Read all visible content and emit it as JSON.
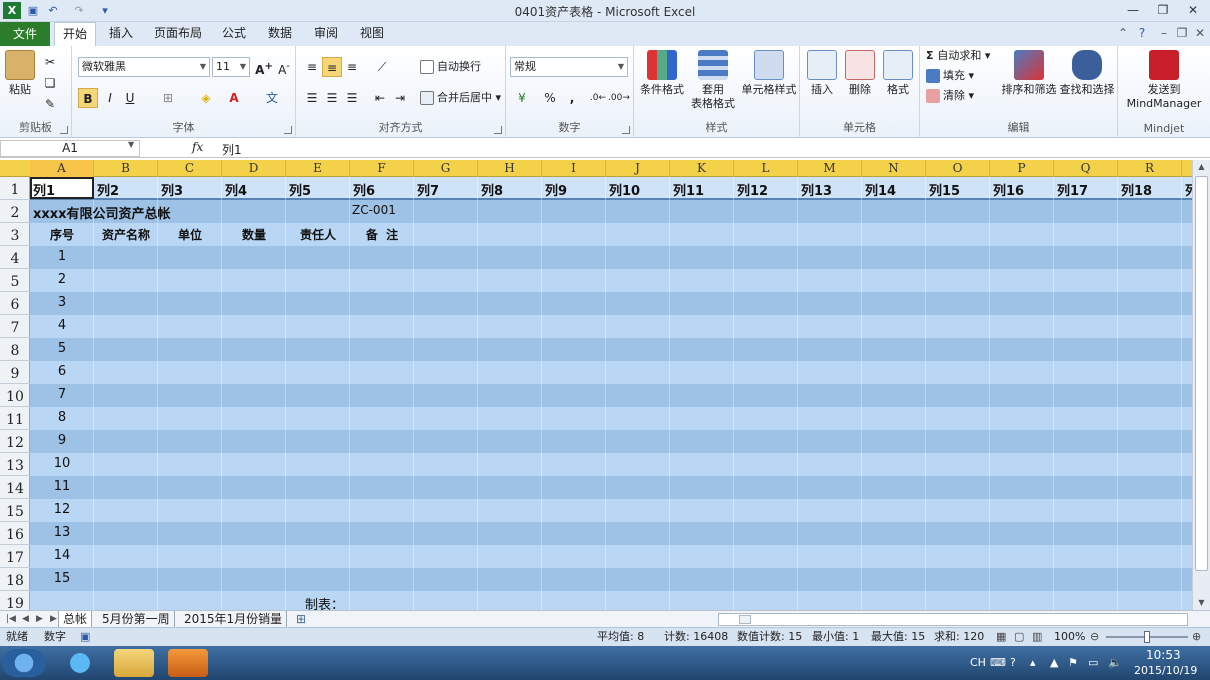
{
  "window": {
    "title": "0401资产表格 - Microsoft Excel"
  },
  "ribbon_tabs": [
    "文件",
    "开始",
    "插入",
    "页面布局",
    "公式",
    "数据",
    "审阅",
    "视图"
  ],
  "clipboard": {
    "paste": "粘贴",
    "label": "剪贴板"
  },
  "font": {
    "name": "微软雅黑",
    "size": "11",
    "label": "字体",
    "bold": "B",
    "italic": "I",
    "underline": "U"
  },
  "alignment": {
    "wrap": "自动换行",
    "merge": "合并后居中",
    "label": "对齐方式"
  },
  "number": {
    "format": "常规",
    "percent": "%",
    "comma": ",",
    "label": "数字"
  },
  "styles": {
    "conditional": "条件格式",
    "table_l1": "套用",
    "table_l2": "表格格式",
    "cell": "单元格样式",
    "label": "样式"
  },
  "cells": {
    "insert": "插入",
    "delete": "删除",
    "format": "格式",
    "label": "单元格"
  },
  "editing": {
    "autosum": "自动求和",
    "fill": "填充",
    "clear": "清除",
    "sort": "排序和筛选",
    "find": "查找和选择",
    "label": "编辑"
  },
  "mindjet": {
    "send_l1": "发送到",
    "send_l2": "MindManager",
    "label": "Mindjet"
  },
  "formula_bar": {
    "name_box": "A1",
    "fx": "fx",
    "content": "列1"
  },
  "columns": [
    "A",
    "B",
    "C",
    "D",
    "E",
    "F",
    "G",
    "H",
    "I",
    "J",
    "K",
    "L",
    "M",
    "N",
    "O",
    "P",
    "Q",
    "R"
  ],
  "rows": [
    "1",
    "2",
    "3",
    "4",
    "5",
    "6",
    "7",
    "8",
    "9",
    "10",
    "11",
    "12",
    "13",
    "14",
    "15",
    "16",
    "17",
    "18",
    "19"
  ],
  "table_headers": [
    "列1",
    "列2",
    "列3",
    "列4",
    "列5",
    "列6",
    "列7",
    "列8",
    "列9",
    "列10",
    "列11",
    "列12",
    "列13",
    "列14",
    "列15",
    "列16",
    "列17",
    "列18",
    "列"
  ],
  "sheet": {
    "title": "xxxx有限公司资产总帐",
    "code": "ZC-001",
    "headers": [
      "序号",
      "资产名称",
      "单位",
      "数量",
      "责任人",
      "备  注"
    ],
    "serials": [
      "1",
      "2",
      "3",
      "4",
      "5",
      "6",
      "7",
      "8",
      "9",
      "10",
      "11",
      "12",
      "13",
      "14",
      "15"
    ],
    "preparer": "制表："
  },
  "sheet_tabs": [
    "总帐",
    "5月份第一周",
    "2015年1月份销量"
  ],
  "status": {
    "ready": "就绪",
    "mode": "数字",
    "average": "平均值: 8",
    "count": "计数: 16408",
    "numcount": "数值计数: 15",
    "min": "最小值: 1",
    "max": "最大值: 15",
    "sum": "求和: 120",
    "zoom": "100%"
  },
  "taskbar": {
    "ime": "CH",
    "time": "10:53",
    "date": "2015/10/19"
  },
  "colors": {
    "band_dark": "#9ec1e6",
    "band_light": "#b9d7f4",
    "header_band": "#c7dff7",
    "col_header": "#f3d24a",
    "file_tab": "#2b7d2b"
  }
}
